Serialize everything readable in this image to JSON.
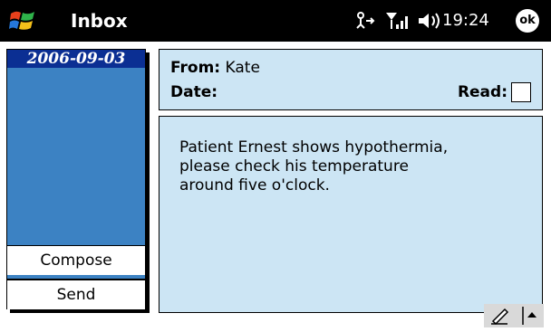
{
  "titlebar": {
    "app_title": "Inbox",
    "clock": "19:24",
    "ok_label": "ok",
    "icons": [
      "windows-start-icon",
      "connectivity-icon",
      "signal-icon",
      "volume-icon"
    ]
  },
  "left_pane": {
    "date_item": "2006-09-03",
    "compose_label": "Compose",
    "send_label": "Send"
  },
  "message": {
    "from_label": "From:",
    "from_value": "Kate",
    "date_label": "Date:",
    "date_value": "",
    "read_label": "Read:",
    "read_checked": false,
    "body": "Patient Ernest shows hypothermia,\nplease check his temperature\naround five o'clock."
  },
  "sip": {
    "icons": [
      "pen-icon",
      "up-arrow-icon"
    ]
  },
  "colors": {
    "titlebar_bg": "#000000",
    "pane_blue": "#3c82c3",
    "selected_date_bg": "#0b2f93",
    "box_bg": "#cce5f4"
  }
}
